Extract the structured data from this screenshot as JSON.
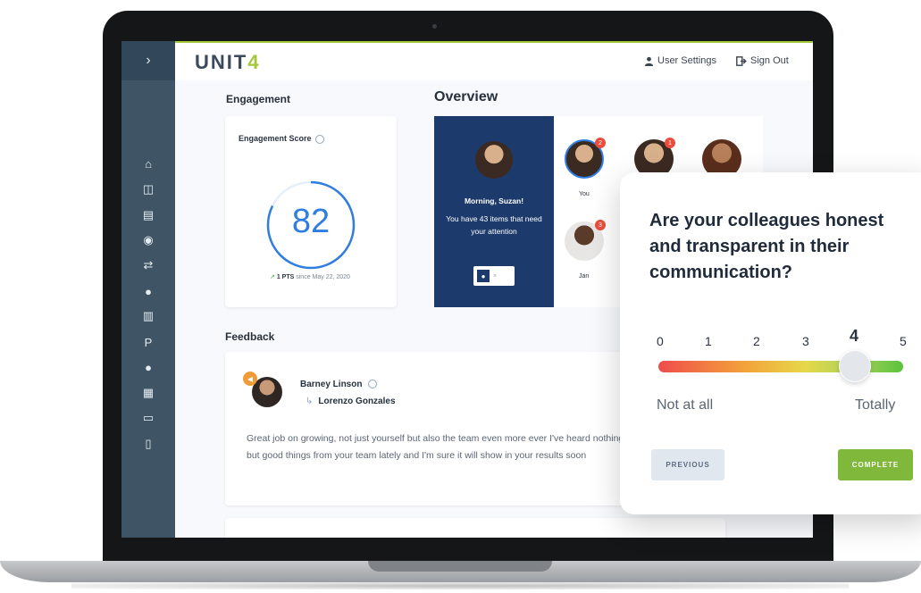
{
  "app": {
    "logo_text": "UNIT",
    "logo_accent": "4",
    "sidebar_toggle": "›",
    "brand_color": "#a4c639"
  },
  "header": {
    "user_settings": "User Settings",
    "sign_out": "Sign Out"
  },
  "sidebar": {
    "items": [
      {
        "icon": "home-icon",
        "glyph": "⌂"
      },
      {
        "icon": "columns-icon",
        "glyph": "◫"
      },
      {
        "icon": "card-icon",
        "glyph": "▤"
      },
      {
        "icon": "target-icon",
        "glyph": "◉"
      },
      {
        "icon": "exchange-icon",
        "glyph": "⇄"
      },
      {
        "icon": "comments-icon",
        "glyph": "●"
      },
      {
        "icon": "book-icon",
        "glyph": "▥"
      },
      {
        "icon": "parking-icon",
        "glyph": "P"
      },
      {
        "icon": "user-icon",
        "glyph": "●"
      },
      {
        "icon": "calendar-icon",
        "glyph": "▦"
      },
      {
        "icon": "credit-card-icon",
        "glyph": "▭"
      },
      {
        "icon": "document-icon",
        "glyph": "▯"
      }
    ]
  },
  "engagement": {
    "title": "Engagement",
    "score_label": "Engagement Score",
    "score": "82",
    "delta_pts": "1 PTS",
    "delta_since": "since May 22, 2020"
  },
  "overview": {
    "title": "Overview",
    "greeting": "Morning, Suzan!",
    "message": "You have 43 items that need your attention",
    "team": [
      {
        "name": "You",
        "badge": "2"
      },
      {
        "name": "",
        "badge": "1"
      },
      {
        "name": "",
        "badge": ""
      },
      {
        "name": "Jan",
        "badge": "3"
      }
    ]
  },
  "feedback": {
    "title": "Feedback",
    "author": "Barney Linson",
    "recipient": "Lorenzo Gonzales",
    "body": "Great job on growing, not just yourself but also the team even more ever I've heard nothing but good things from your team lately and I'm sure it will show in your results soon"
  },
  "survey": {
    "question": "Are your colleagues honest and transparent in their communication?",
    "scale": [
      "0",
      "1",
      "2",
      "3",
      "4",
      "5"
    ],
    "selected_value": 4,
    "min_label": "Not at all",
    "max_label": "Totally",
    "previous_label": "PREVIOUS",
    "complete_label": "COMPLETE"
  }
}
